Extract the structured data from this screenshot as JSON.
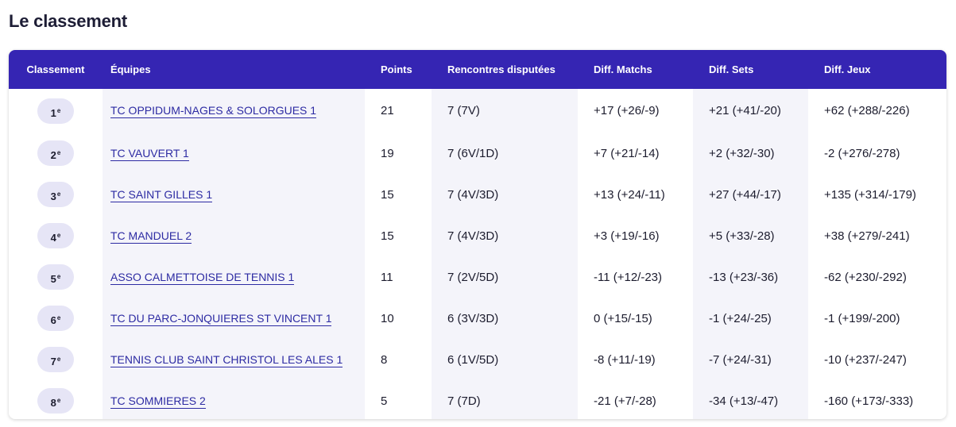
{
  "page": {
    "title": "Le classement"
  },
  "colors": {
    "header_bg": "#3525b3",
    "link": "#2d2ba3",
    "pill_bg": "#e6e5f6",
    "stripe_bg": "#f4f4fa"
  },
  "table": {
    "headers": {
      "rank": "Classement",
      "team": "Équipes",
      "points": "Points",
      "encounters": "Rencontres disputées",
      "diff_matches": "Diff. Matchs",
      "diff_sets": "Diff. Sets",
      "diff_games": "Diff. Jeux"
    },
    "rows": [
      {
        "rank": "1",
        "rank_suffix": "e",
        "team": "TC OPPIDUM-NAGES & SOLORGUES 1",
        "points": "21",
        "encounters": "7 (7V)",
        "diff_matches": "+17 (+26/-9)",
        "diff_sets": "+21 (+41/-20)",
        "diff_games": "+62 (+288/-226)"
      },
      {
        "rank": "2",
        "rank_suffix": "e",
        "team": "TC VAUVERT 1",
        "points": "19",
        "encounters": "7 (6V/1D)",
        "diff_matches": "+7 (+21/-14)",
        "diff_sets": "+2 (+32/-30)",
        "diff_games": "-2 (+276/-278)"
      },
      {
        "rank": "3",
        "rank_suffix": "e",
        "team": "TC SAINT GILLES 1",
        "points": "15",
        "encounters": "7 (4V/3D)",
        "diff_matches": "+13 (+24/-11)",
        "diff_sets": "+27 (+44/-17)",
        "diff_games": "+135 (+314/-179)"
      },
      {
        "rank": "4",
        "rank_suffix": "e",
        "team": "TC MANDUEL 2",
        "points": "15",
        "encounters": "7 (4V/3D)",
        "diff_matches": "+3 (+19/-16)",
        "diff_sets": "+5 (+33/-28)",
        "diff_games": "+38 (+279/-241)"
      },
      {
        "rank": "5",
        "rank_suffix": "e",
        "team": "ASSO CALMETTOISE DE TENNIS 1",
        "points": "11",
        "encounters": "7 (2V/5D)",
        "diff_matches": "-11 (+12/-23)",
        "diff_sets": "-13 (+23/-36)",
        "diff_games": "-62 (+230/-292)"
      },
      {
        "rank": "6",
        "rank_suffix": "e",
        "team": "TC DU PARC-JONQUIERES ST VINCENT 1",
        "points": "10",
        "encounters": "6 (3V/3D)",
        "diff_matches": "0 (+15/-15)",
        "diff_sets": "-1 (+24/-25)",
        "diff_games": "-1 (+199/-200)"
      },
      {
        "rank": "7",
        "rank_suffix": "e",
        "team": "TENNIS CLUB SAINT CHRISTOL LES ALES 1",
        "points": "8",
        "encounters": "6 (1V/5D)",
        "diff_matches": "-8 (+11/-19)",
        "diff_sets": "-7 (+24/-31)",
        "diff_games": "-10 (+237/-247)"
      },
      {
        "rank": "8",
        "rank_suffix": "e",
        "team": "TC SOMMIERES 2",
        "points": "5",
        "encounters": "7 (7D)",
        "diff_matches": "-21 (+7/-28)",
        "diff_sets": "-34 (+13/-47)",
        "diff_games": "-160 (+173/-333)"
      }
    ]
  }
}
